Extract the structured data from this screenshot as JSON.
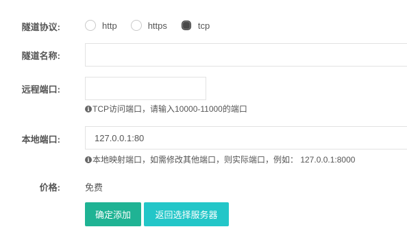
{
  "form": {
    "protocol": {
      "label": "隧道协议:",
      "options": [
        {
          "label": "http",
          "checked": false
        },
        {
          "label": "https",
          "checked": false
        },
        {
          "label": "tcp",
          "checked": true
        }
      ]
    },
    "tunnel_name": {
      "label": "隧道名称:",
      "value": "",
      "placeholder": ""
    },
    "remote_port": {
      "label": "远程端口:",
      "value": "",
      "help": "TCP访问端口，请输入10000-11000的端口"
    },
    "local_port": {
      "label": "本地端口:",
      "value": "127.0.0.1:80",
      "help": "本地映射端口，如需修改其他端口，则实际端口，例如：  127.0.0.1:8000"
    },
    "price": {
      "label": "价格:",
      "value": "免费"
    }
  },
  "buttons": {
    "confirm_label": "确定添加",
    "back_label": "返回选择服务器"
  },
  "colors": {
    "primary": "#1fb394",
    "secondary": "#23c6c8",
    "text": "#555555",
    "border": "#e2e2e2"
  },
  "icons": {
    "help": "info-circle-icon"
  }
}
